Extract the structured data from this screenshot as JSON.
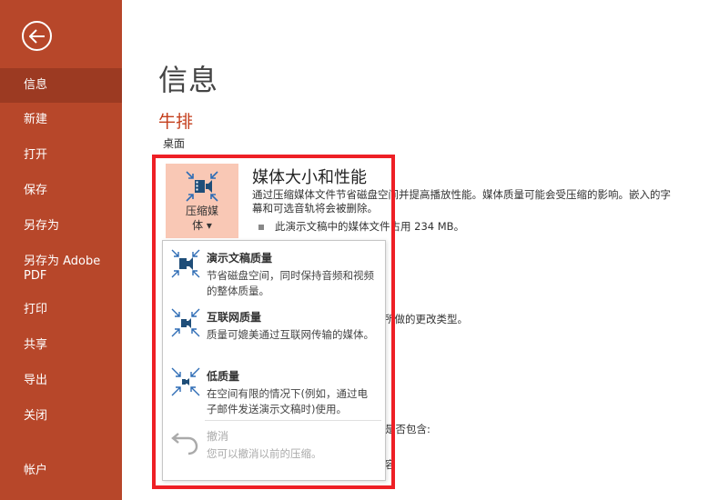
{
  "sidebar": {
    "back_icon": "back-arrow-icon",
    "items": [
      {
        "label": "信息"
      },
      {
        "label": "新建"
      },
      {
        "label": "打开"
      },
      {
        "label": "保存"
      },
      {
        "label": "另存为"
      },
      {
        "label": "另存为 Adobe PDF"
      },
      {
        "label": "打印"
      },
      {
        "label": "共享"
      },
      {
        "label": "导出"
      },
      {
        "label": "关闭"
      },
      {
        "label": "帐户"
      }
    ],
    "active_color": "#9c3a22",
    "bg_color": "#b7472a"
  },
  "main": {
    "title": "信息",
    "doc_name": "牛排",
    "doc_location": "桌面"
  },
  "media": {
    "button_label_line1": "压缩媒",
    "button_label_line2": "体 ▾",
    "section_title": "媒体大小和性能",
    "section_desc": "通过压缩媒体文件节省磁盘空间并提高播放性能。媒体质量可能会受压缩的影响。嵌入的字幕和可选音轨将会被删除。",
    "bullet_text": "此演示文稿中的媒体文件占用 234 MB。"
  },
  "background_fragments": {
    "frag1": "所做的更改类型。",
    "frag2": "是否包含:",
    "frag3": "容"
  },
  "dropdown": {
    "items": [
      {
        "title": "演示文稿质量",
        "desc": "节省磁盘空间，同时保持音频和视频的整体质量。",
        "icon": "compress-presentation-icon"
      },
      {
        "title": "互联网质量",
        "desc": "质量可媲美通过互联网传输的媒体。",
        "icon": "compress-internet-icon"
      },
      {
        "title": "低质量",
        "desc": "在空间有限的情况下(例如，通过电子邮件发送演示文稿时)使用。",
        "icon": "compress-low-icon"
      },
      {
        "title": "撤消",
        "desc": "您可以撤消以前的压缩。",
        "icon": "undo-icon"
      }
    ]
  },
  "colors": {
    "accent": "#c43e1c",
    "highlight": "#ee1f25"
  }
}
